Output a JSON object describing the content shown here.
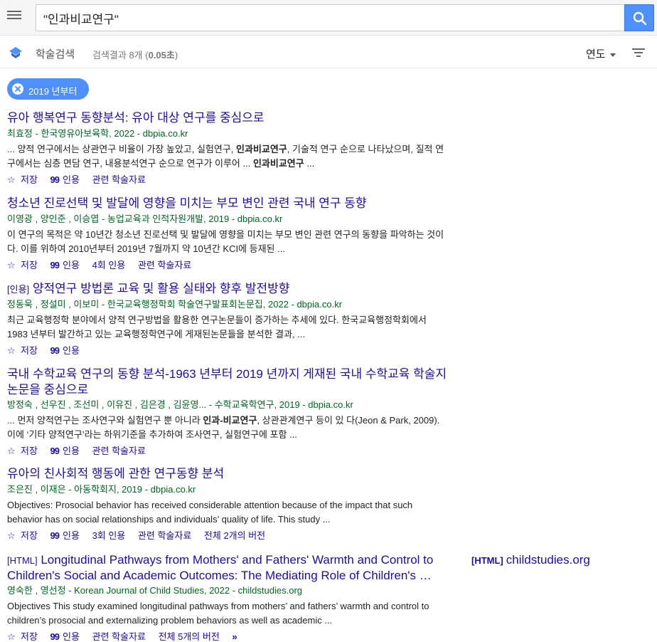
{
  "search": {
    "query": "\"인과비교연구\""
  },
  "subbar": {
    "label": "학술검색",
    "count_prefix": "검색결과 8개 (",
    "count_time": "0.05초",
    "count_suffix": ")",
    "sort_label": "연도"
  },
  "chip": {
    "label": "2019 년부터"
  },
  "results": [
    {
      "tag": "",
      "title": "유아 행복연구 동향분석: 유아 대상 연구를 중심으로",
      "meta": "최효정 - 한국영유아보육학, 2022 - dbpia.co.kr",
      "snippet_parts": [
        "... 양적 연구에서는 상관연구 비율이 가장 높았고, 실험연구, ",
        "인과비교연구",
        ", 기술적 연구 순으로 나타났으며, 질적 연구에서는 심층 면담 연구, 내용분석연구 순으로 연구가 이루어 ... ",
        "인과비교연구",
        " ..."
      ],
      "actions": [
        "저장",
        "인용",
        "관련 학술자료"
      ]
    },
    {
      "tag": "",
      "title": "청소년 진로선택 및 발달에 영향을 미치는 부모 변인 관련 국내 연구 동향",
      "meta": "이영광 ,  양인준 ,  이승엽 - 농업교육과 인적자원개발, 2019 - dbpia.co.kr",
      "snippet_parts": [
        "이 연구의 목적은 약 10년간 청소년 진로선택 및 발달에 영향을 미치는 부모 변인 관련 연구의 동향을 파악하는 것이다. 이를 위하여 2010년부터 2019년 7월까지 약 10년간 KCI에 등재된 ..."
      ],
      "actions": [
        "저장",
        "인용",
        "4회 인용",
        "관련 학술자료"
      ]
    },
    {
      "tag": "[인용]",
      "title": " 양적연구 방법론 교육 및 활용 실태와 향후 발전방향",
      "meta": "정동욱 ,  정설미 ,  이보미 - 한국교육행정학회 학술연구발표회논문집, 2022 - dbpia.co.kr",
      "snippet_parts": [
        "최근 교육행정학 분야에서 양적 연구방법을 활용한 연구논문들이 증가하는 추세에 있다. 한국교육행정학회에서 1983 년부터 발간하고 있는 교육행정학연구에 게재된논문들을 분석한 결과, ..."
      ],
      "actions": [
        "저장",
        "인용"
      ]
    },
    {
      "tag": "",
      "title": "국내 수학교육 연구의 동향 분석-1963 년부터 2019 년까지 게재된 국내 수학교육 학술지 논문을 중심으로",
      "meta": "방정숙 ,  선우진 ,  조선미 ,  이유진 ,  김은경 ,  김윤영... - 수학교육학연구, 2019 - dbpia.co.kr",
      "snippet_parts": [
        "... 먼저 양적연구는 조사연구와 실험연구 뿐 아니라 ",
        "인과-비교연구",
        ", 상관관계연구 등이 있 다(Jeon & Park, 2009). 이에 ‘기타 양적연구’라는 하위기준을 추가하여 조사연구, 실험연구에 포함 ..."
      ],
      "actions": [
        "저장",
        "인용",
        "관련 학술자료"
      ]
    },
    {
      "tag": "",
      "title": "유아의 친사회적 행동에 관한 연구동향 분석",
      "meta": "조은진 ,  이재은 - 아동학회지, 2019 - dbpia.co.kr",
      "snippet_parts": [
        "Objectives: Prosocial behavior has received considerable attention because of the impact that such behavior has on social relationships and individuals’ quality of life. This study ..."
      ],
      "actions": [
        "저장",
        "인용",
        "3회 인용",
        "관련 학술자료",
        "전체 2개의 버전"
      ]
    },
    {
      "tag": "[HTML]",
      "title": " Longitudinal Pathways from Mothers' and Fathers' Warmth and Control to Children's Social and Academic Outcomes: The Mediating Role of Children's …",
      "meta": "영숙한 ,  영선정 - Korean Journal of Child Studies, 2022 - childstudies.org",
      "snippet_parts": [
        "Objectives This study examined longitudinal pathways from mothers’ and fathers’ warmth and control to children’s prosocial and externalizing problem behaviors as well as academic ..."
      ],
      "actions": [
        "저장",
        "인용",
        "관련 학술자료",
        "전체 5개의 버전"
      ]
    }
  ],
  "side_link": {
    "tag": "[HTML]",
    "label": "childstudies.org"
  },
  "colors": {
    "accent": "#4d90fe",
    "link": "#1a0dab",
    "meta": "#006621"
  }
}
